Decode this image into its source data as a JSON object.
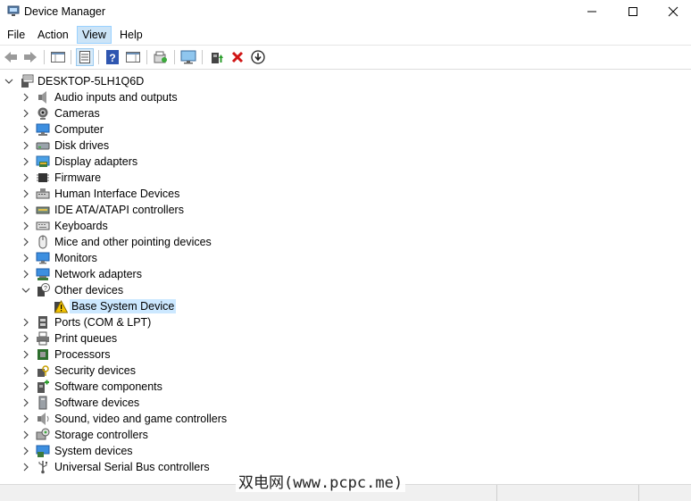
{
  "window": {
    "title": "Device Manager"
  },
  "menu": [
    {
      "label": "File"
    },
    {
      "label": "Action"
    },
    {
      "label": "View",
      "active": true
    },
    {
      "label": "Help"
    }
  ],
  "toolbar": [
    "back-icon",
    "forward-icon",
    "properties-pane-icon",
    "device-list-icon",
    "help-icon",
    "action-pane-icon",
    "scan-hardware-icon",
    "monitor-icon",
    "update-driver-icon",
    "uninstall-icon",
    "download-icon"
  ],
  "tree": {
    "root": {
      "label": "DESKTOP-5LH1Q6D",
      "expanded": true
    },
    "categories": [
      {
        "label": "Audio inputs and outputs",
        "icon": "speaker-icon"
      },
      {
        "label": "Cameras",
        "icon": "camera-icon"
      },
      {
        "label": "Computer",
        "icon": "computer-icon"
      },
      {
        "label": "Disk drives",
        "icon": "disk-icon"
      },
      {
        "label": "Display adapters",
        "icon": "display-adapter-icon"
      },
      {
        "label": "Firmware",
        "icon": "chip-icon"
      },
      {
        "label": "Human Interface Devices",
        "icon": "hid-icon"
      },
      {
        "label": "IDE ATA/ATAPI controllers",
        "icon": "ide-icon"
      },
      {
        "label": "Keyboards",
        "icon": "keyboard-icon"
      },
      {
        "label": "Mice and other pointing devices",
        "icon": "mouse-icon"
      },
      {
        "label": "Monitors",
        "icon": "monitor-icon"
      },
      {
        "label": "Network adapters",
        "icon": "network-icon"
      },
      {
        "label": "Other devices",
        "icon": "unknown-device-icon",
        "expanded": true,
        "children": [
          {
            "label": "Base System Device",
            "icon": "warning-device-icon",
            "selected": true
          }
        ]
      },
      {
        "label": "Ports (COM & LPT)",
        "icon": "port-icon"
      },
      {
        "label": "Print queues",
        "icon": "printer-icon"
      },
      {
        "label": "Processors",
        "icon": "processor-icon"
      },
      {
        "label": "Security devices",
        "icon": "security-icon"
      },
      {
        "label": "Software components",
        "icon": "software-component-icon"
      },
      {
        "label": "Software devices",
        "icon": "software-device-icon"
      },
      {
        "label": "Sound, video and game controllers",
        "icon": "sound-icon"
      },
      {
        "label": "Storage controllers",
        "icon": "storage-icon"
      },
      {
        "label": "System devices",
        "icon": "system-icon"
      },
      {
        "label": "Universal Serial Bus controllers",
        "icon": "usb-icon"
      }
    ]
  },
  "watermark": "双电网(www.pcpc.me)"
}
